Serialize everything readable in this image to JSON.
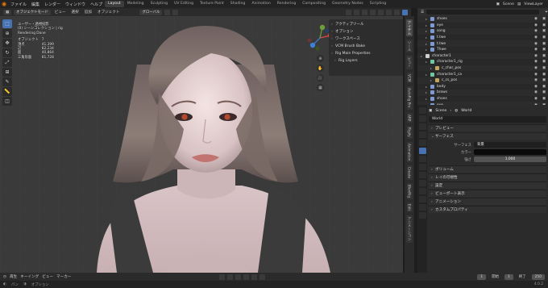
{
  "menubar": {
    "logo_icon": "blender-icon",
    "menus": [
      "ファイル",
      "編集",
      "レンダー",
      "ウィンドウ",
      "ヘルプ"
    ],
    "workspaces": [
      "Layout",
      "Modeling",
      "Sculpting",
      "UV Editing",
      "Texture Paint",
      "Shading",
      "Animation",
      "Rendering",
      "Compositing",
      "Geometry Nodes",
      "Scripting"
    ],
    "active_workspace": "Layout",
    "scene_label": "Scene",
    "view_layer_label": "ViewLayer"
  },
  "viewport_header": {
    "mode": "オブジェクトモード",
    "menus": [
      "ビュー",
      "選択",
      "追加",
      "オブジェクト"
    ],
    "transform": "グローバル",
    "options_label": "オプション"
  },
  "toolbar": {
    "tools": [
      "select-box-icon",
      "cursor-icon",
      "move-icon",
      "rotate-icon",
      "scale-icon",
      "transform-icon",
      "annotate-icon",
      "measure-icon",
      "add-cube-icon"
    ]
  },
  "stats": {
    "line1": "ユーザー・透視投影",
    "line2": "(0) シーンコレクション | rig",
    "line3": "Rendering Done",
    "header": "オブジェクト",
    "header_value": "7",
    "rows": [
      {
        "label": "頂点",
        "value": "41,399"
      },
      {
        "label": "辺",
        "value": "82,234"
      },
      {
        "label": "面",
        "value": "40,864"
      },
      {
        "label": "三角形面",
        "value": "81,728"
      }
    ]
  },
  "npanel": {
    "items": [
      "アクティブツール",
      "オプション",
      "ワークスペース",
      "VCM Brush Bake",
      "Rig Main Properties",
      "Rig Layers"
    ]
  },
  "side_tabs": [
    "アイテム",
    "ツール",
    "ビュー",
    "VCM",
    "AutoRig Pro",
    "ARP",
    "Rigify",
    "Animation",
    "Create",
    "BlenRig",
    "Edit",
    "アニメーション"
  ],
  "outliner": {
    "search_placeholder": "",
    "rows": [
      {
        "name": "shoes",
        "type": "mesh",
        "indent": 1
      },
      {
        "name": "eye",
        "type": "mesh",
        "indent": 1
      },
      {
        "name": "song",
        "type": "mesh",
        "indent": 1
      },
      {
        "name": "t.twe",
        "type": "mesh",
        "indent": 1
      },
      {
        "name": "t.twe",
        "type": "mesh",
        "indent": 1
      },
      {
        "name": "Thwe",
        "type": "mesh",
        "indent": 1
      },
      {
        "name": "character1",
        "type": "coll",
        "indent": 0
      },
      {
        "name": "character1_rig",
        "type": "arm",
        "indent": 1
      },
      {
        "name": "c_char_pos",
        "type": "empty",
        "indent": 2
      },
      {
        "name": "character1_ca",
        "type": "arm",
        "indent": 1
      },
      {
        "name": "c_cs_pos",
        "type": "empty",
        "indent": 2
      },
      {
        "name": "body",
        "type": "mesh",
        "indent": 1
      },
      {
        "name": "brows",
        "type": "mesh",
        "indent": 1
      },
      {
        "name": "shoes",
        "type": "mesh",
        "indent": 1
      },
      {
        "name": "eye",
        "type": "mesh",
        "indent": 1
      },
      {
        "name": "song",
        "type": "mesh",
        "indent": 1
      }
    ]
  },
  "properties": {
    "breadcrumb_scene": "Scene",
    "breadcrumb_world": "World",
    "world_name": "World",
    "panels": [
      {
        "label": "プレビュー",
        "open": false
      },
      {
        "label": "サーフェス",
        "open": true
      }
    ],
    "surface": {
      "label": "サーフェス",
      "value": "背景"
    },
    "color": {
      "label": "カラー"
    },
    "strength": {
      "label": "強さ",
      "value": "1.000"
    },
    "panels_after": [
      "ボリューム",
      "レイの可視性",
      "設定",
      "ビューポート表示",
      "アニメーション",
      "カスタムプロパティ"
    ]
  },
  "timeline": {
    "menus": [
      "再生",
      "キーイング",
      "ビュー",
      "マーカー"
    ],
    "start_label": "開始",
    "start": "1",
    "end_label": "終了",
    "end": "250",
    "current": "1"
  },
  "statusbar": {
    "left": "パン",
    "mid": "オプション",
    "version": "4.0.2"
  }
}
